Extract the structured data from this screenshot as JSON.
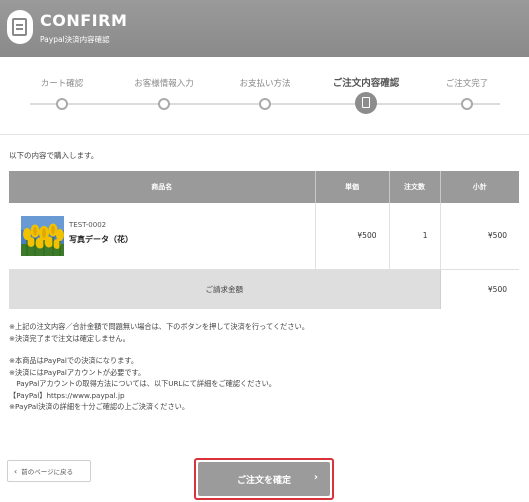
{
  "header": {
    "title": "CONFIRM",
    "subtitle": "Paypal決済内容確認"
  },
  "steps": [
    {
      "label": "カート確認",
      "active": false
    },
    {
      "label": "お客様情報入力",
      "active": false
    },
    {
      "label": "お支払い方法",
      "active": false
    },
    {
      "label": "ご注文内容確認",
      "active": true
    },
    {
      "label": "ご注文完了",
      "active": false
    }
  ],
  "intro": "以下の内容で購入します。",
  "table": {
    "headers": {
      "name": "商品名",
      "price": "単価",
      "qty": "注文数",
      "subtotal": "小計"
    },
    "items": [
      {
        "code": "TEST-0002",
        "name": "写真データ（花）",
        "price": "¥500",
        "qty": "1",
        "subtotal": "¥500"
      }
    ],
    "total_label": "ご請求金額",
    "total_value": "¥500"
  },
  "notes": [
    "※上記の注文内容／合計金額で問題無い場合は、下のボタンを押して決済を行ってください。",
    "※決済完了まで注文は確定しません。",
    "",
    "※本商品はPayPalでの決済になります。",
    "※決済にはPayPalアカウントが必要です。",
    "　PayPalアカウントの取得方法については、以下URLにて詳細をご確認ください。",
    "【PayPal】https://www.paypal.jp",
    "※PayPal決済の詳細を十分ご確認の上ご決済ください。"
  ],
  "buttons": {
    "back_label": "前のページに戻る",
    "confirm_label": "ご注文を確定"
  },
  "colors": {
    "header_bg": "#8a8a8a",
    "table_header_bg": "#9a9a9a",
    "confirm_bg": "#9b9b9b",
    "confirm_highlight": "#d9323a"
  }
}
